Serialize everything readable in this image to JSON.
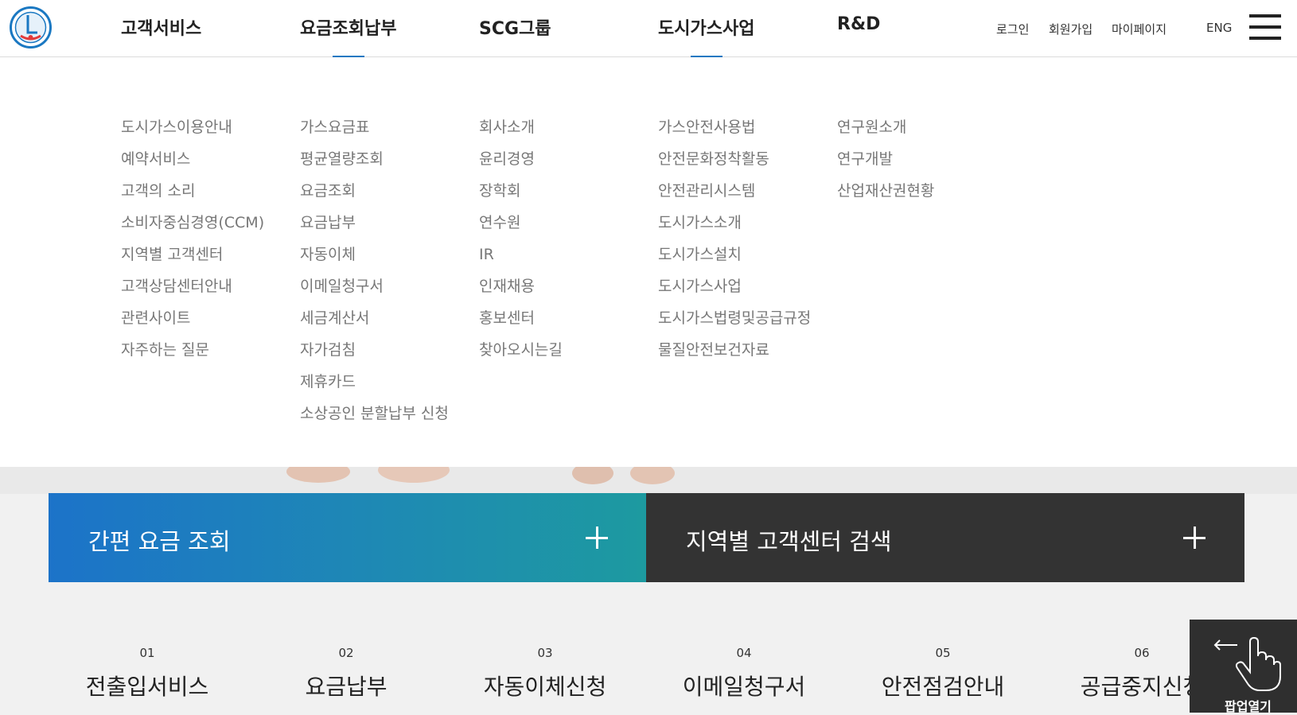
{
  "gnb": {
    "items": [
      {
        "label": "고객서비스"
      },
      {
        "label": "요금조회납부"
      },
      {
        "label": "SCG그룹"
      },
      {
        "label": "도시가스사업"
      },
      {
        "label": "R&D"
      }
    ]
  },
  "util": {
    "login": "로그인",
    "join": "회원가입",
    "mypage": "마이페이지",
    "eng": "ENG"
  },
  "submenu": {
    "col1": [
      "도시가스이용안내",
      "예약서비스",
      "고객의 소리",
      "소비자중심경영(CCM)",
      "지역별 고객센터",
      "고객상담센터안내",
      "관련사이트",
      "자주하는 질문"
    ],
    "col2": [
      "가스요금표",
      "평균열량조회",
      "요금조회",
      "요금납부",
      "자동이체",
      "이메일청구서",
      "세금계산서",
      "자가검침",
      "제휴카드",
      "소상공인 분할납부 신청"
    ],
    "col3": [
      "회사소개",
      "윤리경영",
      "장학회",
      "연수원",
      "IR",
      "인재채용",
      "홍보센터",
      "찾아오시는길"
    ],
    "col4": [
      "가스안전사용법",
      "안전문화정착활동",
      "안전관리시스템",
      "도시가스소개",
      "도시가스설치",
      "도시가스사업",
      "도시가스법령및공급규정",
      "물질안전보건자료"
    ],
    "col5": [
      "연구원소개",
      "연구개발",
      "산업재산권현황"
    ]
  },
  "quick": {
    "fee_label": "간편 요금 조회",
    "center_label": "지역별 고객센터 검색"
  },
  "services": [
    {
      "num": "01",
      "title": "전출입서비스"
    },
    {
      "num": "02",
      "title": "요금납부"
    },
    {
      "num": "03",
      "title": "자동이체신청"
    },
    {
      "num": "04",
      "title": "이메일청구서"
    },
    {
      "num": "05",
      "title": "안전점검안내"
    },
    {
      "num": "06",
      "title": "공급중지신청"
    }
  ],
  "popup": {
    "label": "팝업열기"
  },
  "colors": {
    "accent": "#1a78c2",
    "dark_bar": "#333333",
    "popup_bg": "#2f2f2f"
  }
}
